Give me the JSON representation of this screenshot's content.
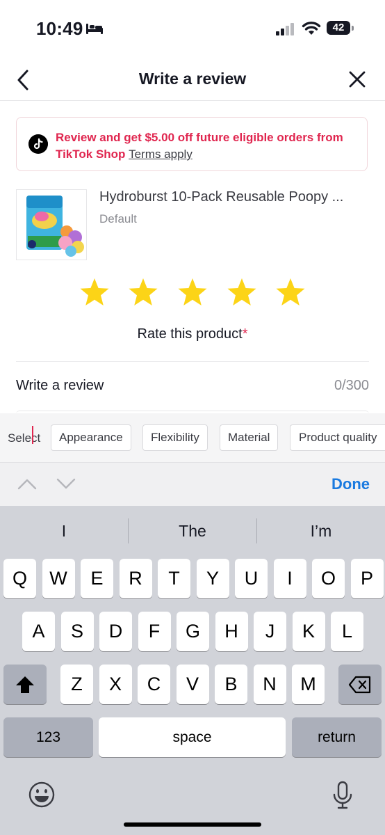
{
  "status_bar": {
    "time": "10:49",
    "battery": "42"
  },
  "nav": {
    "title": "Write a review"
  },
  "banner": {
    "text": "Review and get $5.00 off future eligible orders from TikTok Shop",
    "link": "Terms apply"
  },
  "product": {
    "name": "Hydroburst 10-Pack Reusable Poopy ...",
    "variant": "Default"
  },
  "rating": {
    "stars": 5,
    "max": 5,
    "label": "Rate this product",
    "required_mark": "*",
    "color": "#fcd417"
  },
  "review": {
    "title": "Write a review",
    "count": "0/300"
  },
  "tags": {
    "select_label": "Select",
    "items": [
      "Appearance",
      "Flexibility",
      "Material",
      "Product quality"
    ]
  },
  "keyboard": {
    "accessory_done": "Done",
    "suggestions": [
      "I",
      "The",
      "I’m"
    ],
    "row1": [
      "Q",
      "W",
      "E",
      "R",
      "T",
      "Y",
      "U",
      "I",
      "O",
      "P"
    ],
    "row2": [
      "A",
      "S",
      "D",
      "F",
      "G",
      "H",
      "J",
      "K",
      "L"
    ],
    "row3": [
      "Z",
      "X",
      "C",
      "V",
      "B",
      "N",
      "M"
    ],
    "numbers_key": "123",
    "space_key": "space",
    "return_key": "return"
  },
  "colors": {
    "accent": "#e0264f",
    "link_blue": "#1a7ae0"
  }
}
